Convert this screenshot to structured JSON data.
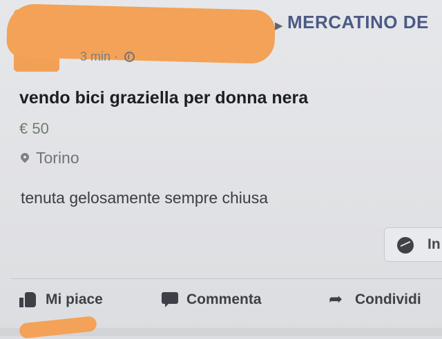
{
  "post": {
    "group_name": "MERCATINO DE",
    "group_arrow": "▶",
    "time": "3 min",
    "time_separator": "·",
    "title": "vendo bici graziella per donna nera",
    "price": "€ 50",
    "location": "Torino",
    "description": "tenuta gelosamente sempre chiusa"
  },
  "message_button": {
    "label": "In",
    "icon": "messenger-icon"
  },
  "actions": {
    "like_label": "Mi piace",
    "comment_label": "Commenta",
    "share_label": "Condividi"
  },
  "icons": {
    "like": "thumbs-up-icon",
    "comment": "comment-bubble-icon",
    "share": "share-arrow-icon",
    "privacy": "globe-icon",
    "location": "location-pin-icon"
  },
  "colors": {
    "group_name": "#4b5a85",
    "price": "#6e7d6c",
    "redaction": "#f3a257",
    "background": "#e3e4e7"
  }
}
